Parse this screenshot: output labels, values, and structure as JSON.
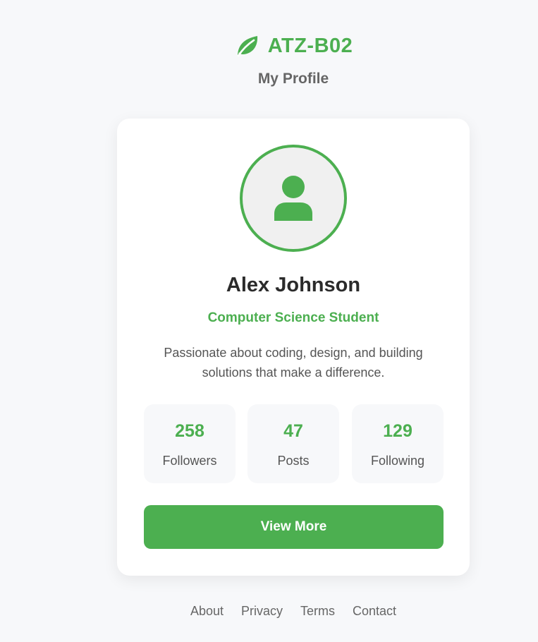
{
  "brand": {
    "name": "ATZ-B02",
    "icon": "leaf-icon",
    "color": "#4caf50"
  },
  "header": {
    "subtitle": "My Profile"
  },
  "profile": {
    "avatar_icon": "user-icon",
    "name": "Alex Johnson",
    "role": "Computer Science Student",
    "bio": "Passionate about coding, design, and building solutions that make a difference.",
    "stats": [
      {
        "value": "258",
        "label": "Followers"
      },
      {
        "value": "47",
        "label": "Posts"
      },
      {
        "value": "129",
        "label": "Following"
      }
    ],
    "button_label": "View More"
  },
  "footer": {
    "links": [
      "About",
      "Privacy",
      "Terms",
      "Contact"
    ]
  },
  "colors": {
    "accent": "#4caf50",
    "background": "#f7f8fa",
    "card": "#ffffff"
  }
}
